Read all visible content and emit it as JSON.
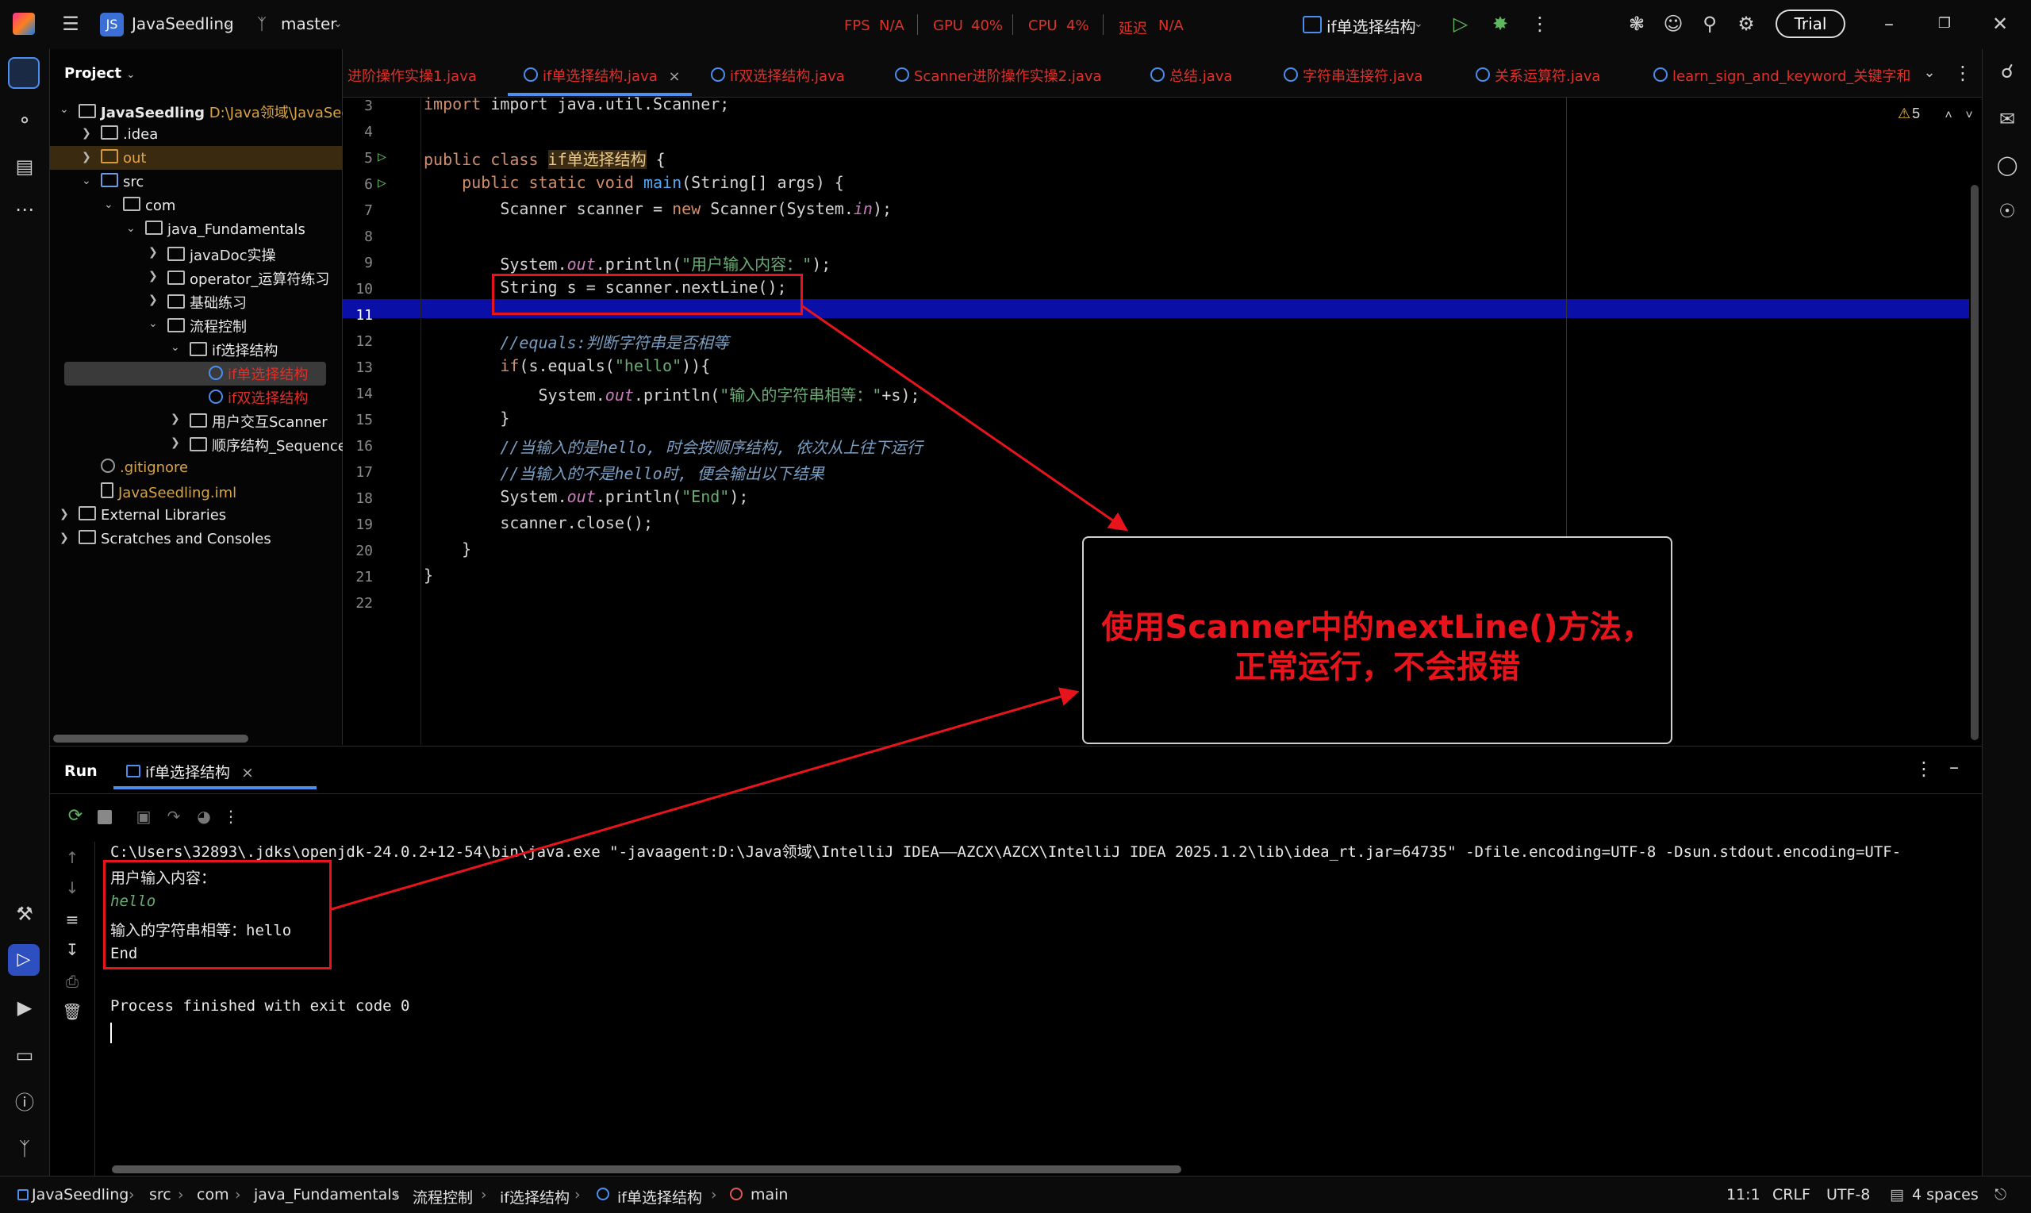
{
  "titlebar": {
    "project_badge": "JS",
    "project_name": "JavaSeedling",
    "branch": "master",
    "fps_label": "FPS",
    "fps_value": "N/A",
    "gpu_label": "GPU",
    "gpu_value": "40%",
    "cpu_label": "CPU",
    "cpu_value": "4%",
    "latency_label": "延迟",
    "latency_value": "N/A",
    "run_config": "if单选择结构",
    "trial_label": "Trial"
  },
  "project_panel": {
    "title": "Project",
    "items": [
      {
        "label": "JavaSeedling",
        "path": "D:\\Java领域\\JavaSeec"
      },
      {
        "label": ".idea"
      },
      {
        "label": "out"
      },
      {
        "label": "src"
      },
      {
        "label": "com"
      },
      {
        "label": "java_Fundamentals"
      },
      {
        "label": "javaDoc实操"
      },
      {
        "label": "operator_运算符练习"
      },
      {
        "label": "基础练习"
      },
      {
        "label": "流程控制"
      },
      {
        "label": "if选择结构"
      },
      {
        "label": "if单选择结构"
      },
      {
        "label": "if双选择结构"
      },
      {
        "label": "用户交互Scanner"
      },
      {
        "label": "顺序结构_Sequence"
      },
      {
        "label": ".gitignore"
      },
      {
        "label": "JavaSeedling.iml"
      },
      {
        "label": "External Libraries"
      },
      {
        "label": "Scratches and Consoles"
      }
    ]
  },
  "tabs": [
    {
      "label": "进阶操作实操1.java"
    },
    {
      "label": "if单选择结构.java"
    },
    {
      "label": "if双选择结构.java"
    },
    {
      "label": "Scanner进阶操作实操2.java"
    },
    {
      "label": "总结.java"
    },
    {
      "label": "字符串连接符.java"
    },
    {
      "label": "关系运算符.java"
    },
    {
      "label": "learn_sign_and_keyword_关键字和"
    }
  ],
  "editor": {
    "warning_count": "5",
    "lines": [
      "3",
      "4",
      "5",
      "6",
      "7",
      "8",
      "9",
      "10",
      "11",
      "12",
      "13",
      "14",
      "15",
      "16",
      "17",
      "18",
      "19",
      "20",
      "21",
      "22"
    ],
    "code": {
      "l3": "import java.util.Scanner;",
      "l5a": "public class ",
      "l5b": "if单选择结构",
      "l5c": " {",
      "l6a": "    public static void ",
      "l6b": "main",
      "l6c": "(String[] args) {",
      "l7a": "        Scanner scanner = ",
      "l7b": "new",
      "l7c": " Scanner(System.",
      "l7d": "in",
      "l7e": ");",
      "l9a": "        System.",
      "l9b": "out",
      "l9c": ".println(",
      "l9d": "\"用户输入内容：\"",
      "l9e": ");",
      "l10": "        String s = scanner.nextLine();",
      "l12": "        //equals:判断字符串是否相等",
      "l13a": "        ",
      "l13b": "if",
      "l13c": "(s.equals(",
      "l13d": "\"hello\"",
      "l13e": ")){",
      "l14a": "            System.",
      "l14b": "out",
      "l14c": ".println(",
      "l14d": "\"输入的字符串相等：\"",
      "l14e": "+s);",
      "l15": "        }",
      "l16": "        //当输入的是hello, 时会按顺序结构, 依次从上往下运行",
      "l17": "        //当输入的不是hello时, 便会输出以下结果",
      "l18a": "        System.",
      "l18b": "out",
      "l18c": ".println(",
      "l18d": "\"End\"",
      "l18e": ");",
      "l19": "        scanner.close();",
      "l20": "    }",
      "l21": "}"
    }
  },
  "annotation": {
    "line1": "使用Scanner中的nextLine()方法，",
    "line2": "正常运行，不会报错"
  },
  "run_panel": {
    "title": "Run",
    "tab": "if单选择结构",
    "cmd": "C:\\Users\\32893\\.jdks\\openjdk-24.0.2+12-54\\bin\\java.exe \"-javaagent:D:\\Java领域\\IntelliJ IDEA——AZCX\\AZCX\\IntelliJ IDEA 2025.1.2\\lib\\idea_rt.jar=64735\" -Dfile.encoding=UTF-8 -Dsun.stdout.encoding=UTF-",
    "out1": "用户输入内容：",
    "out2": "hello",
    "out3": "输入的字符串相等：hello",
    "out4": "End",
    "out5": "Process finished with exit code 0"
  },
  "status": {
    "crumbs": [
      "JavaSeedling",
      "src",
      "com",
      "java_Fundamentals",
      "流程控制",
      "if选择结构",
      "if单选择结构",
      "main"
    ],
    "position": "11:1",
    "line_sep": "CRLF",
    "encoding": "UTF-8",
    "indent": "4 spaces"
  },
  "colors": {
    "accent_red": "#e8141c",
    "selection_blue": "#0a0fa8"
  }
}
